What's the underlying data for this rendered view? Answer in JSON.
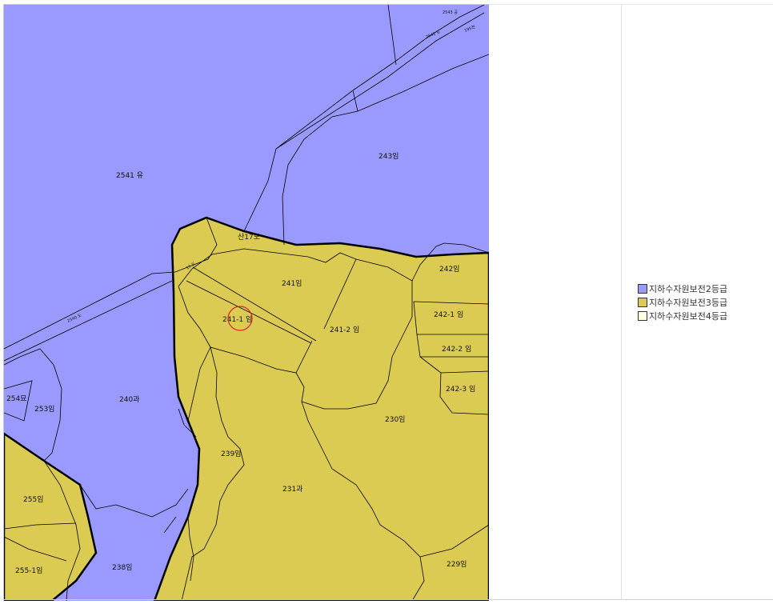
{
  "colors": {
    "grade2": "#9a9afe",
    "grade3": "#dccb52",
    "grade4": "#fffde0",
    "highlight": "#e02020"
  },
  "legend": [
    {
      "label": "지하수자원보전2등급",
      "color": "#9a9afe"
    },
    {
      "label": "지하수자원보전3등급",
      "color": "#dccb52"
    },
    {
      "label": "지하수자원보전4등급",
      "color": "#fffde0"
    }
  ],
  "parcels": {
    "p2541": "2541 유",
    "p243": "243임",
    "p_san17": "산17도",
    "p241": "241임",
    "p242": "242임",
    "p241_1": "241-1 임",
    "p241_2": "241-2 임",
    "p242_1": "242-1 임",
    "p242_2": "242-2 임",
    "p242_3": "242-3 임",
    "p240": "240과",
    "p254": "254묘",
    "p253": "253임",
    "p230": "230임",
    "p239": "239임",
    "p231": "231과",
    "p255": "255임",
    "p255_1": "255-1임",
    "p238": "238임",
    "p229": "229임"
  },
  "road_labels": {
    "r2543": "2543 공",
    "r2542": "2542 도",
    "r195": "195천",
    "r17": "17 도",
    "r2540": "2540 도"
  }
}
